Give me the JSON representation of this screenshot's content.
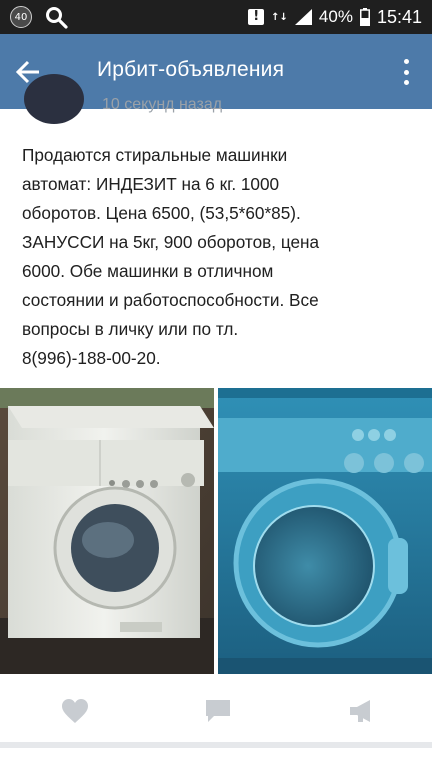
{
  "status_bar": {
    "badge": "40",
    "battery_percent": "40%",
    "time": "15:41",
    "alert_icon": "!",
    "data_indicator": "↑↓"
  },
  "app_bar": {
    "title": "Ирбит-объявления"
  },
  "post": {
    "time": "10 секунд назад",
    "text": "Продаются стиральные машинки\nавтомат: ИНДЕЗИТ на 6 кг. 1000\nоборотов. Цена 6500, (53,5*60*85).\nЗАНУССИ на 5кг,  900 оборотов,  цена\n6000. Обе машинки в отличном\nсостоянии и работоспособности. Все\nвопросы в личку или по тл.\n8(996)-188-00-20."
  },
  "actions": {
    "like": "heart-icon",
    "comment": "comment-icon",
    "share": "share-icon"
  },
  "colors": {
    "app_bar": "#4d7aa9",
    "status_bar": "#1f1f1f",
    "icon_gray": "#c8ccd1"
  }
}
